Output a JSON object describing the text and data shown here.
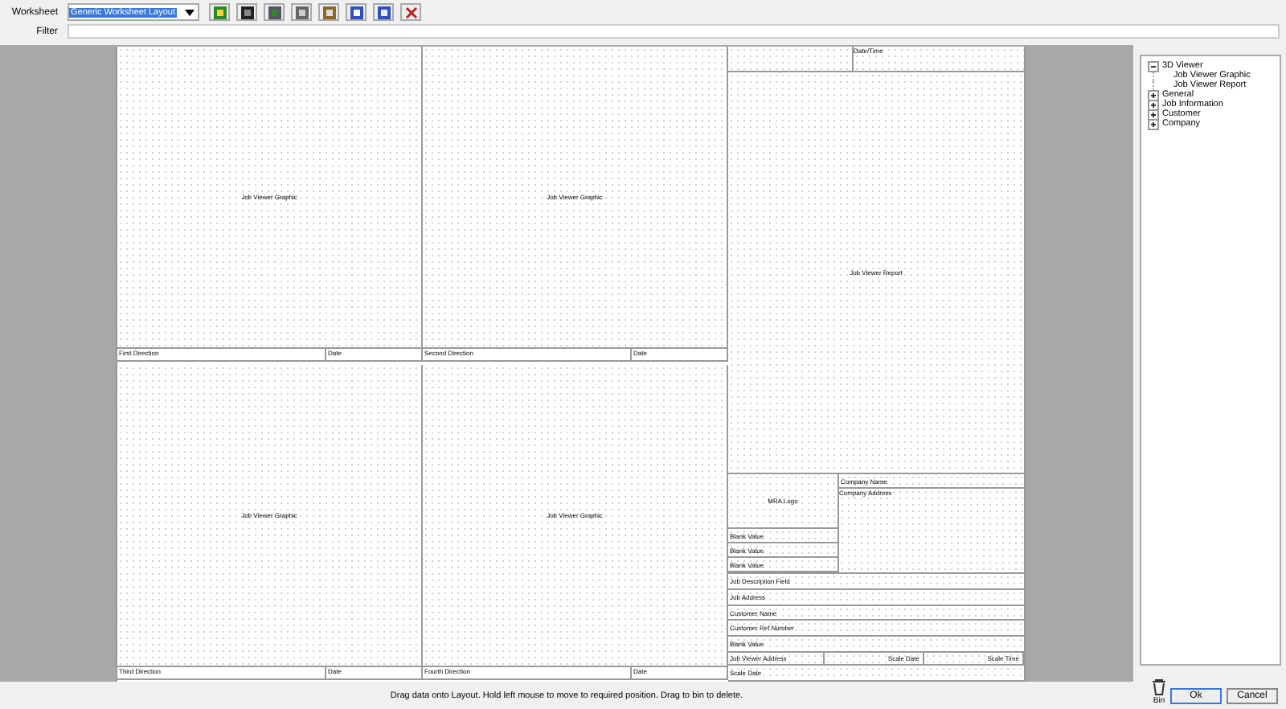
{
  "toolbar": {
    "worksheet_label": "Worksheet",
    "worksheet_value": "Generic Worksheet Layout",
    "filter_label": "Filter"
  },
  "layout": {
    "graphics": [
      {
        "label": "Job Viewer Graphic",
        "caption": "First Direction",
        "date": "Date"
      },
      {
        "label": "Job Viewer Graphic",
        "caption": "Second Direction",
        "date": "Date"
      },
      {
        "label": "Job Viewer Graphic",
        "caption": "Third Direction",
        "date": "Date"
      },
      {
        "label": "Job Viewer Graphic",
        "caption": "Fourth Direction",
        "date": "Date"
      }
    ],
    "header_label": "Date/Time",
    "report_label": "Job Viewer Report",
    "logo_label": "MRA Logo",
    "company_name": "Company Name",
    "company_address": "Company Address",
    "left_fields": [
      "Blank Value",
      "Blank Value",
      "Blank Value"
    ],
    "rows": [
      "Job Description Field",
      "Job Address",
      "Customer Name",
      "Customer Ref Number",
      "Blank Value"
    ],
    "bottom_row": [
      "Job Viewer Address",
      "Scale Date",
      "Scale Time"
    ],
    "last_row": "Scale Date"
  },
  "tree": [
    {
      "label": "3D Viewer",
      "expanded": true,
      "children": [
        {
          "label": "Job Viewer Graphic"
        },
        {
          "label": "Job Viewer Report"
        }
      ]
    },
    {
      "label": "General",
      "expanded": false
    },
    {
      "label": "Job Information",
      "expanded": false
    },
    {
      "label": "Customer",
      "expanded": false
    },
    {
      "label": "Company",
      "expanded": false
    }
  ],
  "status": "Drag data onto Layout. Hold left mouse to move to required position. Drag to bin to delete.",
  "bin_label": "Bin",
  "buttons": [
    "Ok",
    "Cancel"
  ]
}
